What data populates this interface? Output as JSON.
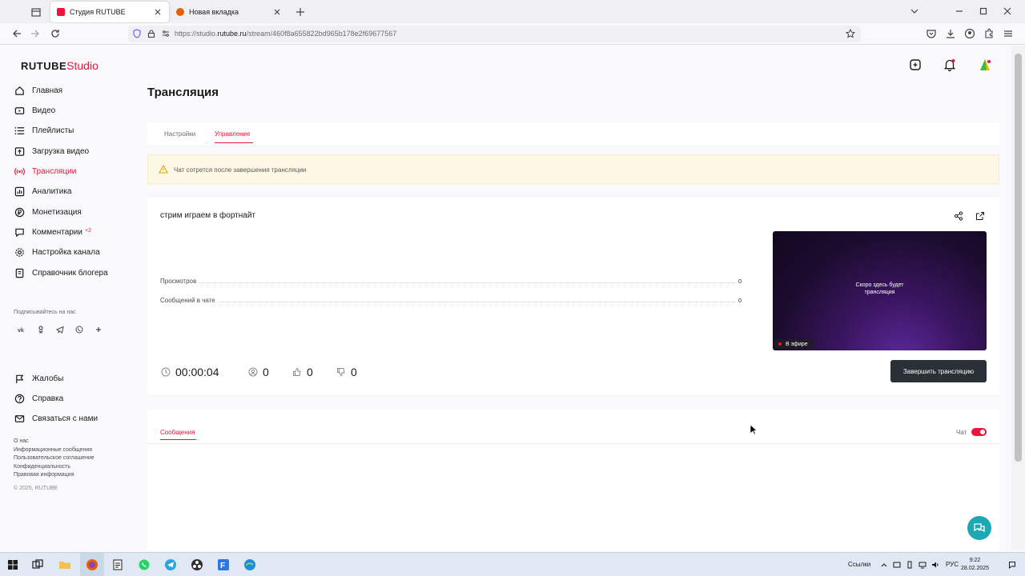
{
  "browser": {
    "tabs": [
      {
        "title": "Студия RUTUBE",
        "active": true,
        "favicon_color": "#ed143b"
      },
      {
        "title": "Новая вкладка",
        "active": false,
        "favicon_color": "#e66000"
      }
    ],
    "url_prefix": "https://studio.",
    "url_domain": "rutube.ru",
    "url_path": "/stream/460f8a655822bd965b178e2f69677567"
  },
  "logo": {
    "main": "RUTUBE",
    "accent": "Studio"
  },
  "sidebar": {
    "items": [
      {
        "label": "Главная",
        "icon": "home-icon"
      },
      {
        "label": "Видео",
        "icon": "video-icon"
      },
      {
        "label": "Плейлисты",
        "icon": "playlist-icon"
      },
      {
        "label": "Загрузка видео",
        "icon": "upload-icon"
      },
      {
        "label": "Трансляции",
        "icon": "broadcast-icon",
        "active": true
      },
      {
        "label": "Аналитика",
        "icon": "analytics-icon"
      },
      {
        "label": "Монетизация",
        "icon": "monetization-icon"
      },
      {
        "label": "Комментарии",
        "icon": "comments-icon",
        "badge": "+2"
      },
      {
        "label": "Настройка канала",
        "icon": "settings-icon"
      },
      {
        "label": "Справочник блогера",
        "icon": "handbook-icon"
      }
    ],
    "subscribe_label": "Подписывайтесь на нас",
    "socials": [
      "vk-icon",
      "ok-icon",
      "telegram-icon",
      "viber-icon",
      "plus-icon"
    ],
    "secondary": [
      {
        "label": "Жалобы",
        "icon": "flag-icon"
      },
      {
        "label": "Справка",
        "icon": "help-icon"
      },
      {
        "label": "Связаться с нами",
        "icon": "mail-icon"
      }
    ],
    "footer_links": [
      "О нас",
      "Информационные сообщения",
      "Пользовательское соглашение",
      "Конфиденциальность",
      "Правовая информация"
    ],
    "copyright": "© 2025, RUTUBE"
  },
  "page": {
    "title": "Трансляция",
    "tabs": [
      {
        "label": "Настройки",
        "active": false
      },
      {
        "label": "Управление",
        "active": true
      }
    ],
    "alert": "Чат сотрется после завершения трансляции",
    "stream": {
      "title": "стрим играем в фортнайт",
      "stats": [
        {
          "label": "Просмотров",
          "value": "0"
        },
        {
          "label": "Сообщений в чате",
          "value": "0"
        }
      ],
      "preview_text_line1": "Скоро здесь будет",
      "preview_text_line2": "трансляция",
      "live_label": "В эфире",
      "duration": "00:00:04",
      "viewers": "0",
      "likes": "0",
      "dislikes": "0",
      "end_button": "Завершить трансляцию"
    },
    "messages_tab": "Сообщения",
    "chat_toggle_label": "Чат",
    "chat_enabled": true
  },
  "taskbar": {
    "links_label": "Ссылки",
    "lang": "РУС",
    "time": "9:22",
    "date": "28.02.2025"
  },
  "colors": {
    "accent": "#ed143b",
    "dark_button": "#2b2f36",
    "support": "#1ea7b4"
  }
}
